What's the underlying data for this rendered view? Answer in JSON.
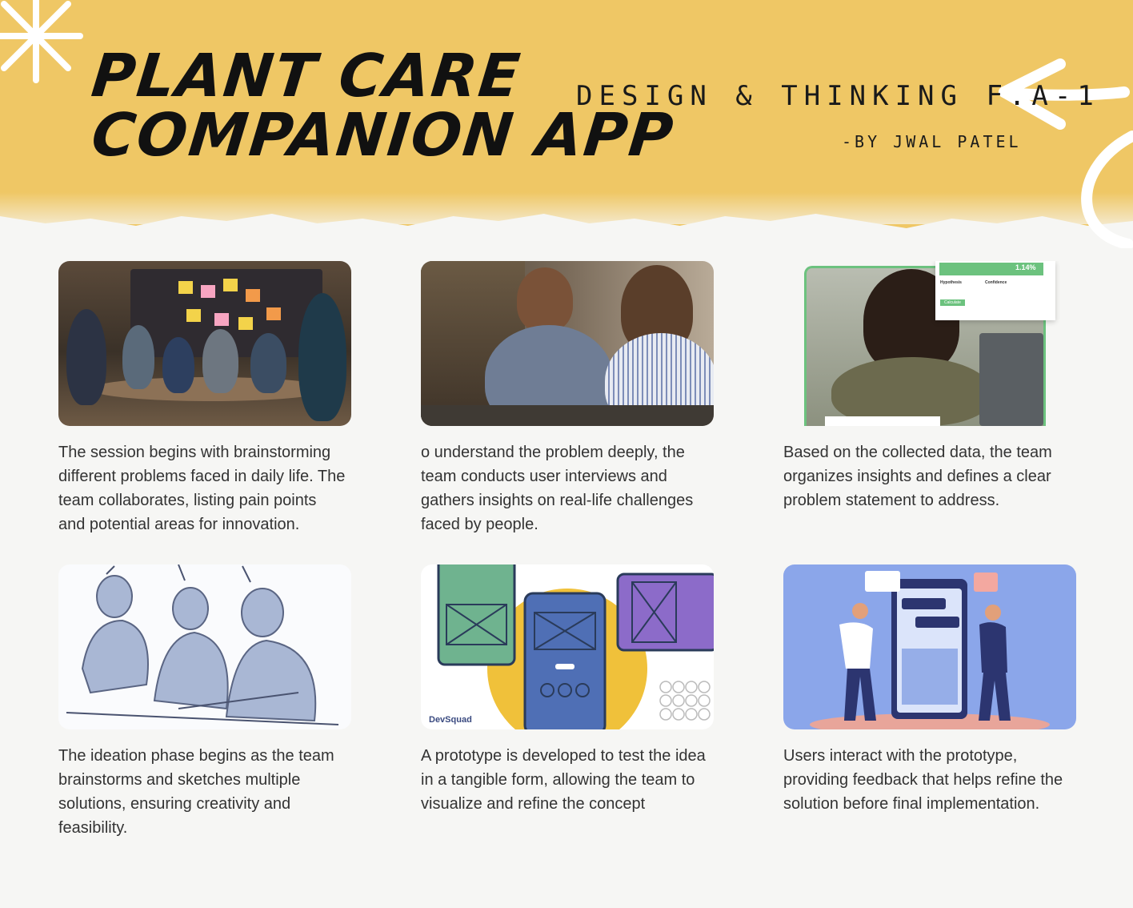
{
  "header": {
    "title_line1": "PLANT CARE",
    "title_line2": "COMPANION APP",
    "subtitle": "DESIGN & THINKING F.A-1",
    "byline": "-BY JWAL PATEL"
  },
  "colors": {
    "header_bg": "#efc765",
    "page_bg": "#f6f6f4",
    "text": "#333333"
  },
  "cards": [
    {
      "image": "team-brainstorming-photo",
      "text": "The session begins with brainstorming different problems faced in daily life. The team collaborates, listing pain points and potential areas for innovation."
    },
    {
      "image": "user-interview-photo",
      "text": "o understand the problem deeply, the team conducts user interviews and gathers insights on real-life challenges faced by people."
    },
    {
      "image": "data-analysis-photo",
      "image_texts": {
        "stat": "1.14%",
        "hypothesis": "Hypothesis",
        "confidence": "Confidence",
        "button": "Calculate"
      },
      "text": "Based on the collected data, the team organizes insights and defines a clear problem statement to address."
    },
    {
      "image": "ideation-sketch",
      "text": "The ideation phase begins as the team brainstorms and sketches multiple solutions, ensuring creativity and feasibility."
    },
    {
      "image": "prototype-wireframes",
      "image_texts": {
        "brand": "DevSquad"
      },
      "text": "A prototype is developed to test the idea in a tangible form, allowing the team to visualize and refine the concept"
    },
    {
      "image": "user-testing-illustration",
      "text": "Users interact with the prototype, providing feedback that helps refine the solution before final implementation."
    }
  ]
}
